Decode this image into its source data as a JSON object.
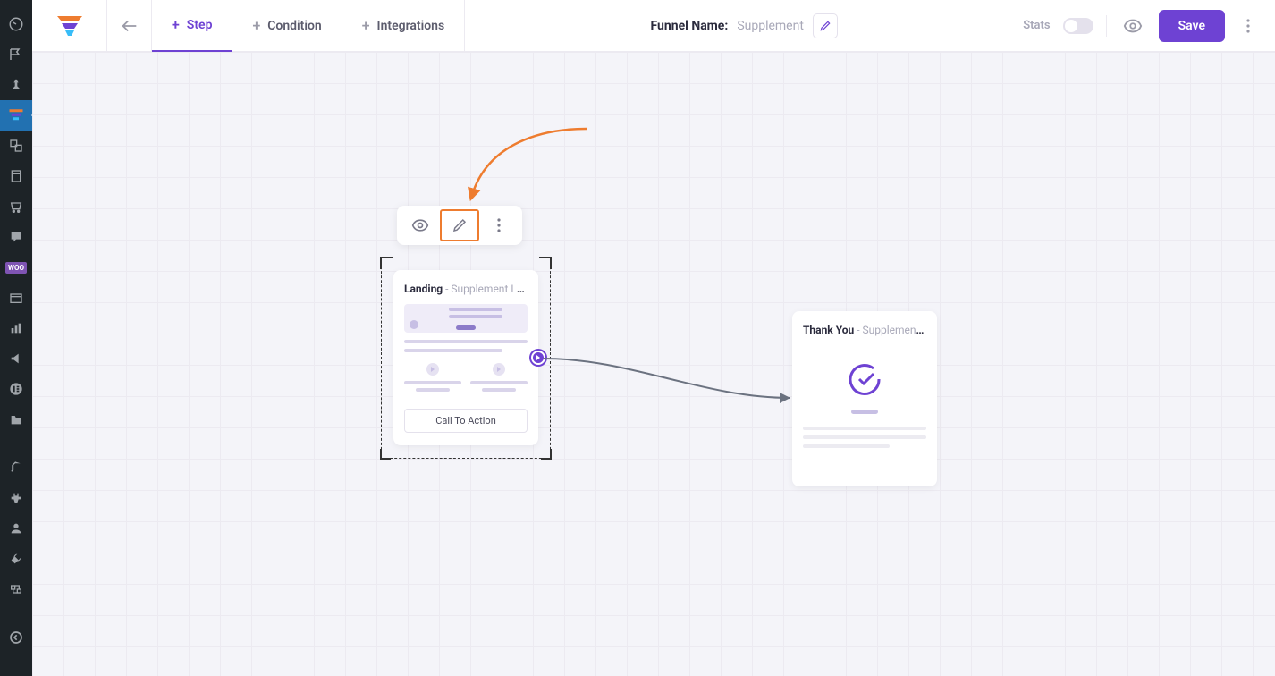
{
  "topbar": {
    "tabs": {
      "step": "Step",
      "condition": "Condition",
      "integrations": "Integrations"
    },
    "funnel_label": "Funnel Name:",
    "funnel_name": "Supplement",
    "stats_label": "Stats",
    "save": "Save"
  },
  "nodes": {
    "landing": {
      "title": "Landing",
      "sub": " - Supplement La...",
      "cta": "Call To Action"
    },
    "thanks": {
      "title": "Thank You",
      "sub": " - Supplement T..."
    }
  }
}
